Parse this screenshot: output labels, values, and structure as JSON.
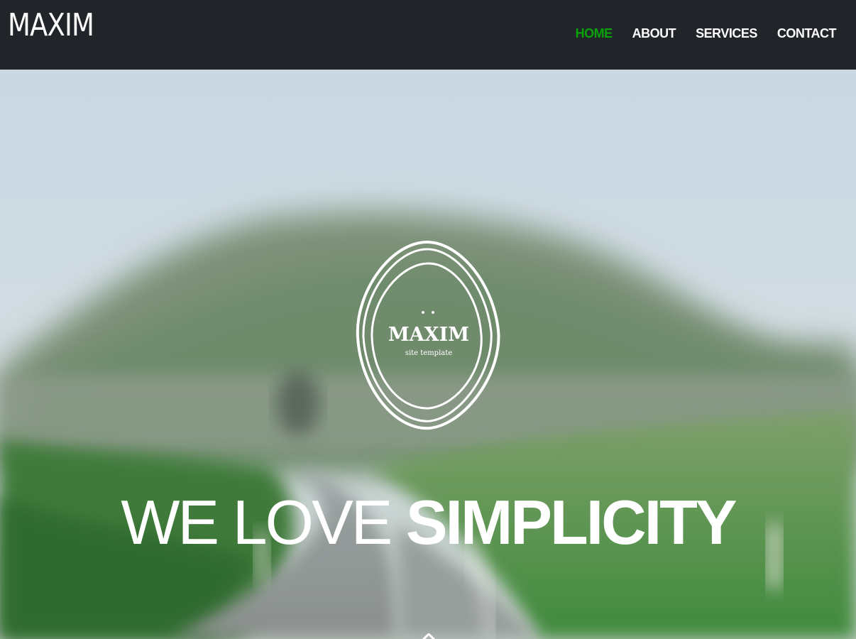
{
  "header": {
    "brand": "MAXIM",
    "nav": [
      {
        "label": "HOME",
        "active": true
      },
      {
        "label": "ABOUT",
        "active": false
      },
      {
        "label": "SERVICES",
        "active": false
      },
      {
        "label": "CONTACT",
        "active": false
      }
    ]
  },
  "hero": {
    "badge_title": "MAXIM",
    "badge_subtitle": "site template",
    "tagline_light": "WE LOVE",
    "tagline_bold": "SIMPLICITY"
  },
  "colors": {
    "navbar_bg": "#212429",
    "active_nav": "#0aa10a",
    "text": "#ffffff"
  },
  "icons": {
    "scroll": "chevron-up-icon"
  }
}
